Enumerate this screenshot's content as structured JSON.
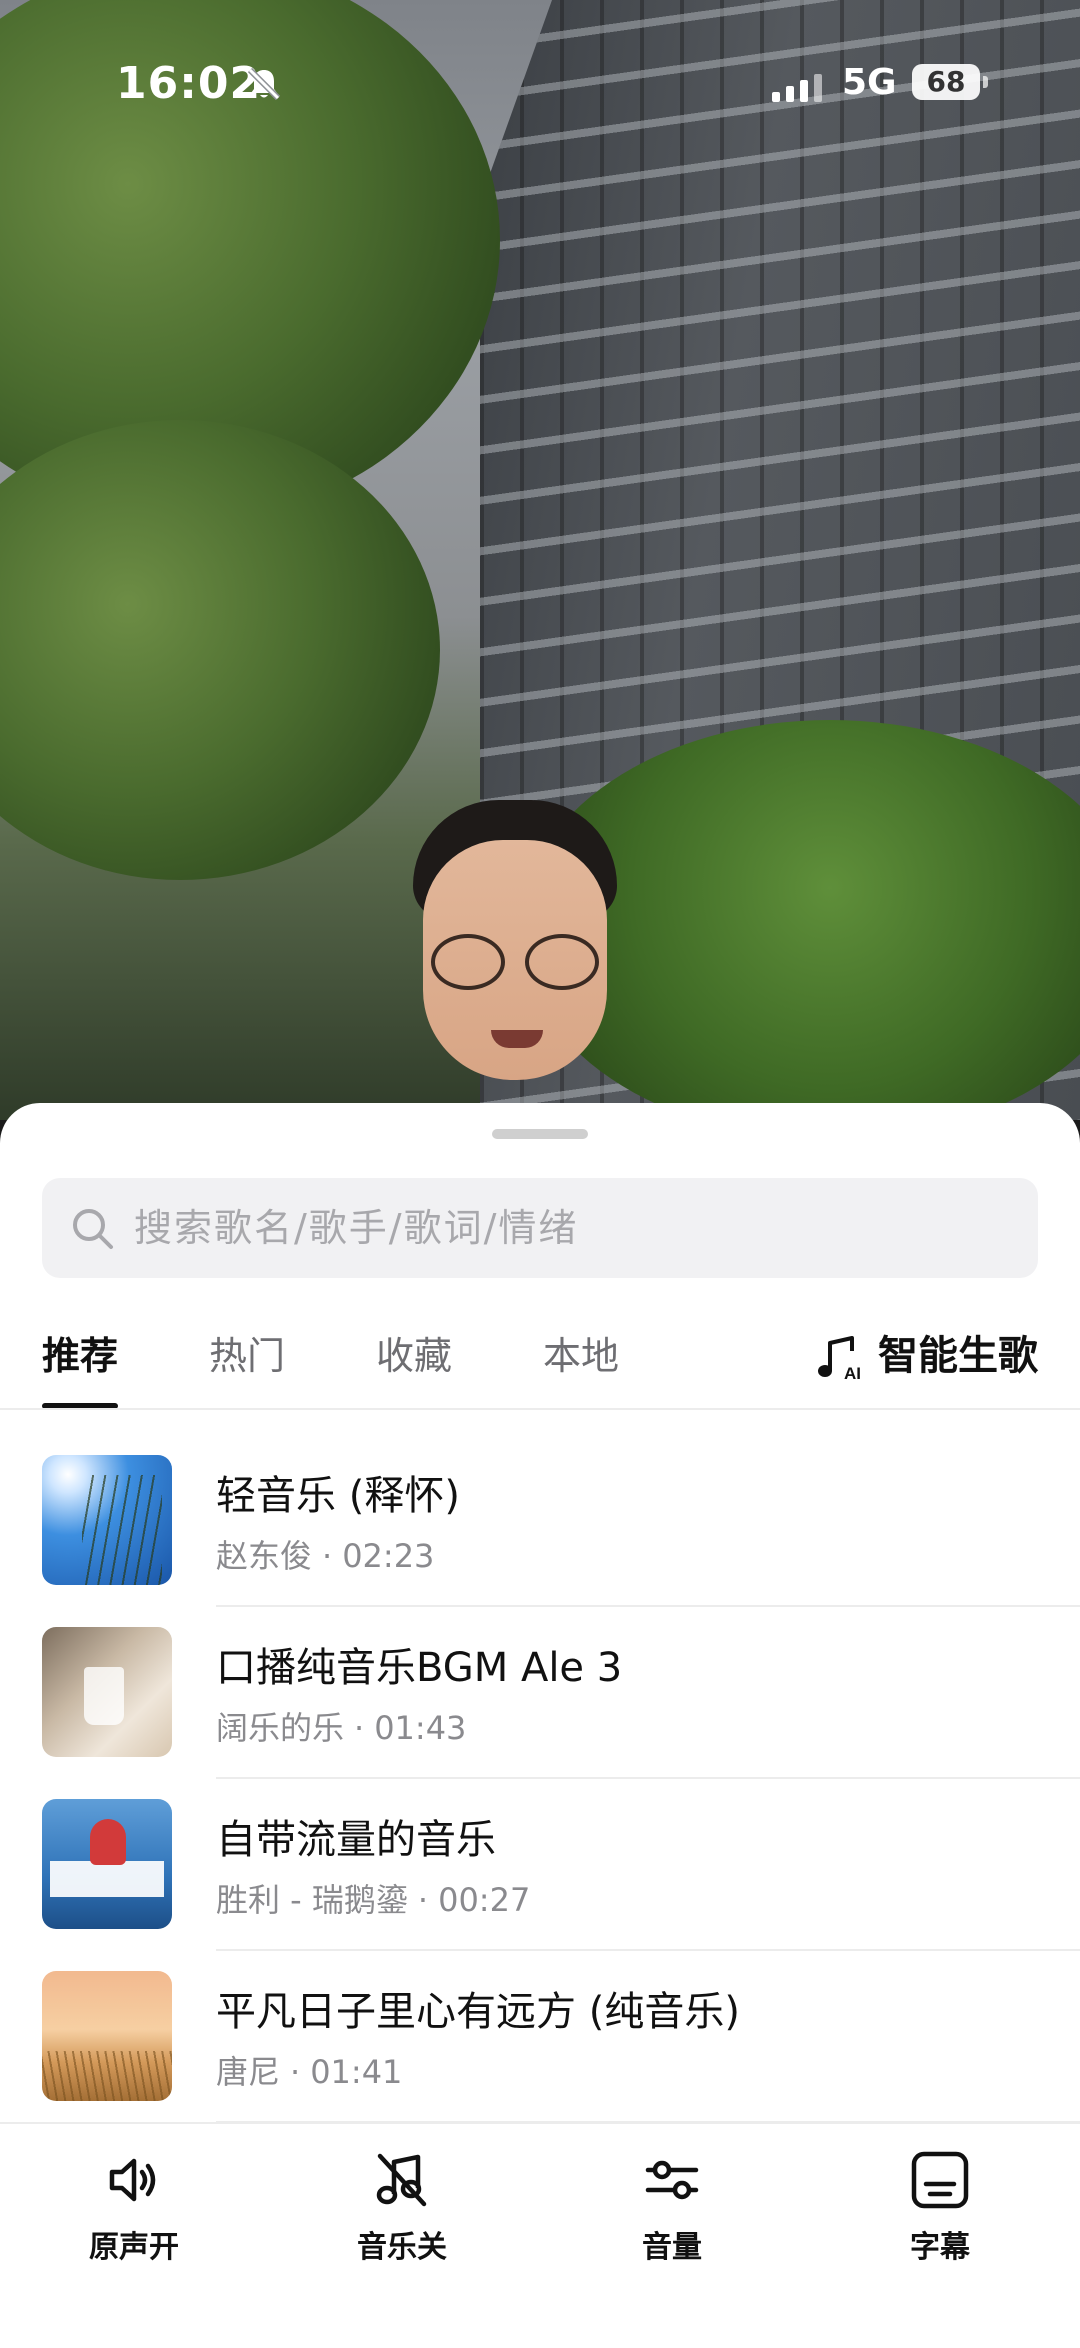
{
  "status_bar": {
    "time": "16:02",
    "network": "5G",
    "battery": "68"
  },
  "search": {
    "placeholder": "搜索歌名/歌手/歌词/情绪"
  },
  "tabs": [
    {
      "label": "推荐",
      "active": true
    },
    {
      "label": "热门",
      "active": false
    },
    {
      "label": "收藏",
      "active": false
    },
    {
      "label": "本地",
      "active": false
    }
  ],
  "ai_tab": {
    "label": "智能生歌",
    "icon": "music-ai-icon"
  },
  "songs": [
    {
      "title": "轻音乐 (释怀)",
      "artist": "赵东俊",
      "duration": "02:23"
    },
    {
      "title": "口播纯音乐BGM Ale 3",
      "artist": "阔乐的乐",
      "duration": "01:43"
    },
    {
      "title": "自带流量的音乐",
      "artist": "胜利 - 瑞鹅鎏",
      "duration": "00:27"
    },
    {
      "title": "平凡日子里心有远方 (纯音乐)",
      "artist": "唐尼",
      "duration": "01:41"
    }
  ],
  "separator_dot": "·",
  "toolbar": [
    {
      "label": "原声开",
      "icon": "speaker-icon"
    },
    {
      "label": "音乐关",
      "icon": "music-off-icon"
    },
    {
      "label": "音量",
      "icon": "sliders-icon"
    },
    {
      "label": "字幕",
      "icon": "subtitles-icon"
    }
  ]
}
